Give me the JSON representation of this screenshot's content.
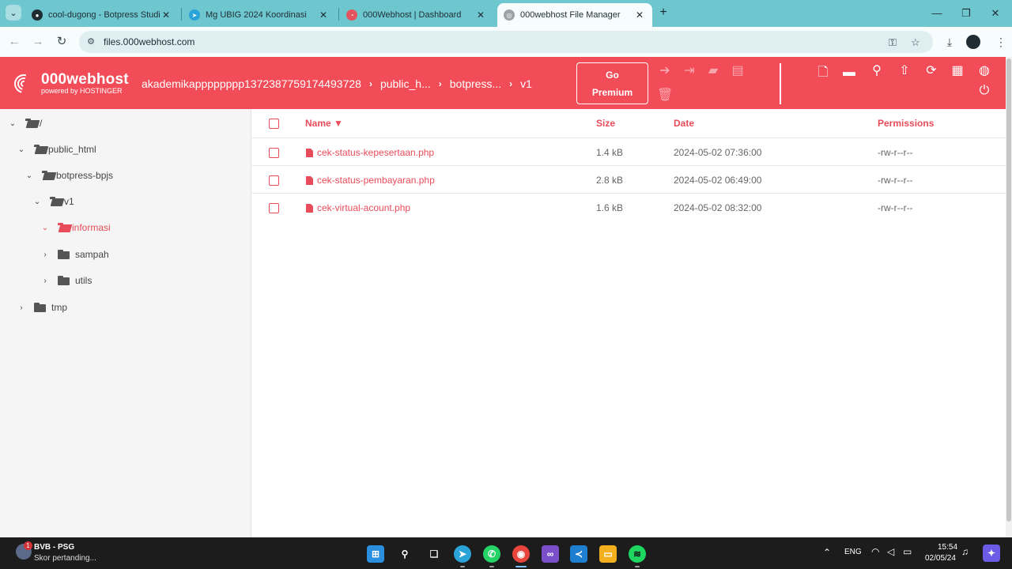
{
  "browser": {
    "tabs": [
      {
        "title": "cool-dugong - Botpress Studio",
        "active": false
      },
      {
        "title": "Mg UBIG 2024 Koordinasi",
        "active": false
      },
      {
        "title": "000Webhost | Dashboard",
        "active": false
      },
      {
        "title": "000webhost File Manager",
        "active": true
      }
    ],
    "url": "files.000webhost.com"
  },
  "header": {
    "logo_main": "000webhost",
    "logo_sub": "powered by HOSTINGER",
    "breadcrumbs": [
      "akademikapppppppp1372387759174493728",
      "public_h...",
      "botpress...",
      "v1"
    ],
    "premium_line1": "Go",
    "premium_line2": "Premium"
  },
  "tree": {
    "root": "/",
    "nodes": [
      {
        "label": "public_html"
      },
      {
        "label": "botpress-bpjs"
      },
      {
        "label": "v1"
      },
      {
        "label": "informasi",
        "active": true
      },
      {
        "label": "sampah"
      },
      {
        "label": "utils"
      },
      {
        "label": "tmp"
      }
    ]
  },
  "table": {
    "columns": {
      "name": "Name ▼",
      "size": "Size",
      "date": "Date",
      "permissions": "Permissions"
    },
    "rows": [
      {
        "name": "cek-status-kepesertaan.php",
        "size": "1.4 kB",
        "date": "2024-05-02 07:36:00",
        "permissions": "-rw-r--r--"
      },
      {
        "name": "cek-status-pembayaran.php",
        "size": "2.8 kB",
        "date": "2024-05-02 06:49:00",
        "permissions": "-rw-r--r--"
      },
      {
        "name": "cek-virtual-acount.php",
        "size": "1.6 kB",
        "date": "2024-05-02 08:32:00",
        "permissions": "-rw-r--r--"
      }
    ]
  },
  "taskbar": {
    "news_badge": "1",
    "news_title": "BVB - PSG",
    "news_sub": "Skor pertanding...",
    "lang": "ENG",
    "time": "15:54",
    "date": "02/05/24"
  },
  "colors": {
    "accent": "#f14c58",
    "tab_strip": "#6ec6cf",
    "link": "#e84c5a"
  }
}
